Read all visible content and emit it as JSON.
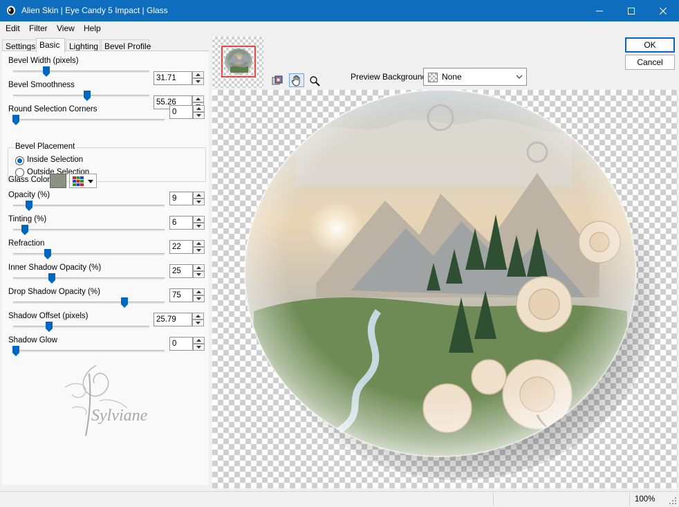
{
  "window": {
    "title": "Alien Skin | Eye Candy 5 Impact | Glass",
    "icon": "alien-skin-icon",
    "controls": [
      "minimize-icon",
      "maximize-icon",
      "close-icon"
    ],
    "titlebar_color": "#0f6dbd"
  },
  "menu": [
    "Edit",
    "Filter",
    "View",
    "Help"
  ],
  "tabs": [
    "Settings",
    "Basic",
    "Lighting",
    "Bevel Profile"
  ],
  "active_tab": "Basic",
  "controls": {
    "bevel_width": {
      "label": "Bevel Width (pixels)",
      "value": "31.71"
    },
    "bevel_smoothness": {
      "label": "Bevel Smoothness",
      "value": "55.26"
    },
    "round_corners": {
      "label": "Round Selection Corners",
      "value": "0"
    },
    "bevel_placement": {
      "legend": "Bevel Placement",
      "options": [
        "Inside Selection",
        "Outside Selection"
      ],
      "selected": "Inside Selection"
    },
    "glass_color": {
      "label": "Glass Color",
      "color": "#8a9284"
    },
    "opacity": {
      "label": "Opacity (%)",
      "value": "9"
    },
    "tinting": {
      "label": "Tinting (%)",
      "value": "6"
    },
    "refraction": {
      "label": "Refraction",
      "value": "22"
    },
    "inner_shadow_opacity": {
      "label": "Inner Shadow Opacity (%)",
      "value": "25"
    },
    "drop_shadow_opacity": {
      "label": "Drop Shadow Opacity (%)",
      "value": "75"
    },
    "shadow_offset": {
      "label": "Shadow Offset (pixels)",
      "value": "25.79"
    },
    "shadow_glow": {
      "label": "Shadow Glow",
      "value": "0"
    }
  },
  "watermark": {
    "text": "Sylviane"
  },
  "preview": {
    "background_label": "Preview Background:",
    "background_value": "None",
    "tools": [
      "navigate-thumbnail-icon",
      "hand-icon",
      "zoom-icon"
    ],
    "active_tool": "hand-icon"
  },
  "buttons": {
    "ok": "OK",
    "cancel": "Cancel"
  },
  "status": {
    "zoom": "100%"
  }
}
